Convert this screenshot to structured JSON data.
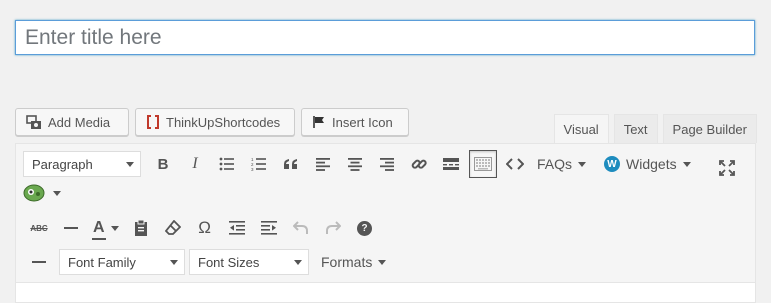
{
  "title": {
    "placeholder": "Enter title here"
  },
  "media_buttons": {
    "add_media": "Add Media",
    "shortcodes": "ThinkUpShortcodes",
    "insert_icon": "Insert Icon"
  },
  "tabs": {
    "visual": "Visual",
    "text": "Text",
    "page_builder": "Page Builder",
    "active": "Visual"
  },
  "toolbar": {
    "paragraph": "Paragraph",
    "bold": "B",
    "italic": "I",
    "faqs": "FAQs",
    "widgets": "Widgets",
    "widgets_badge": "W",
    "strikethrough": "ABC",
    "text_color": "A",
    "omega": "Ω",
    "font_family": "Font Family",
    "font_sizes": "Font Sizes",
    "formats": "Formats",
    "help": "?"
  },
  "colors": {
    "accent": "#1e8cbe",
    "focus_border": "#5b9dd9",
    "plugin_green": "#6aa84f"
  }
}
